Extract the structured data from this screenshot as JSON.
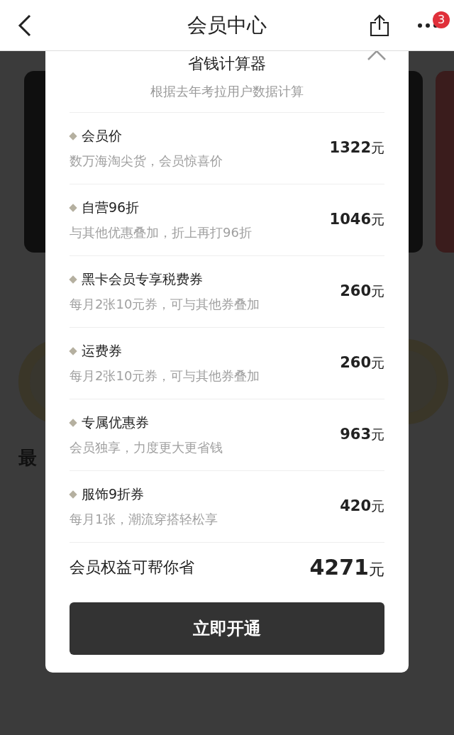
{
  "header": {
    "title": "会员中心",
    "badge": "3"
  },
  "background": {
    "section_title": "最"
  },
  "calculator": {
    "title": "省钱计算器",
    "subtitle": "根据去年考拉用户数据计算",
    "items": [
      {
        "name": "会员价",
        "description": "数万海淘尖货，会员惊喜价",
        "amount": "1322",
        "unit": "元"
      },
      {
        "name": "自营96折",
        "description": "与其他优惠叠加，折上再打96折",
        "amount": "1046",
        "unit": "元"
      },
      {
        "name": "黑卡会员专享税费券",
        "description": "每月2张10元券，可与其他券叠加",
        "amount": "260",
        "unit": "元"
      },
      {
        "name": "运费券",
        "description": "每月2张10元券，可与其他券叠加",
        "amount": "260",
        "unit": "元"
      },
      {
        "name": "专属优惠券",
        "description": "会员独享，力度更大更省钱",
        "amount": "963",
        "unit": "元"
      },
      {
        "name": "服饰9折券",
        "description": "每月1张，潮流穿搭轻松享",
        "amount": "420",
        "unit": "元"
      }
    ],
    "total": {
      "label": "会员权益可帮你省",
      "amount": "4271",
      "unit": "元"
    },
    "button": "立即开通"
  }
}
